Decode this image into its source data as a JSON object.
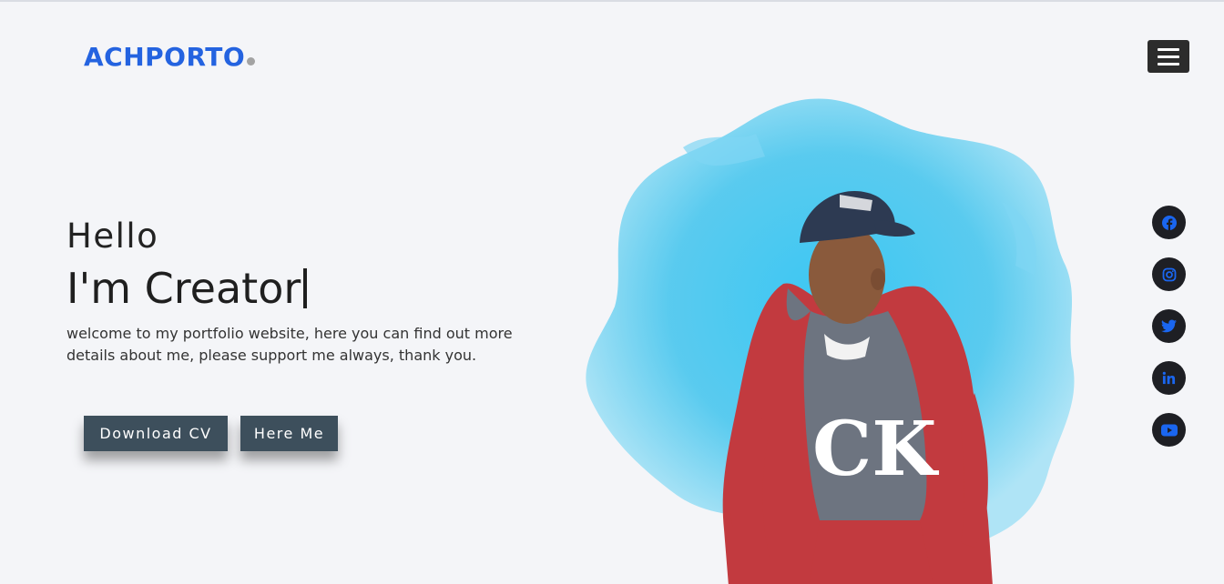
{
  "header": {
    "logo_text": "ACHPORTO",
    "menu_icon": "hamburger-icon"
  },
  "hero": {
    "greeting": "Hello",
    "headline": "I'm Creator",
    "description": "welcome to my portfolio website, here you can find out more details about me, please support me always, thank you.",
    "buttons": {
      "download_label": "Download CV",
      "hire_label": "Here Me"
    },
    "image_logo_text": "CK"
  },
  "social": [
    {
      "icon": "facebook-icon"
    },
    {
      "icon": "instagram-icon"
    },
    {
      "icon": "twitter-icon"
    },
    {
      "icon": "linkedin-icon"
    },
    {
      "icon": "youtube-icon"
    }
  ],
  "colors": {
    "brand": "#2463e0",
    "button_bg": "#3d4f5c",
    "social_bg": "#1e1f24",
    "social_icon": "#1a66f0",
    "splash": "#3cc4ef",
    "hoodie_red": "#c23a3f",
    "hoodie_gray": "#6d7480"
  }
}
